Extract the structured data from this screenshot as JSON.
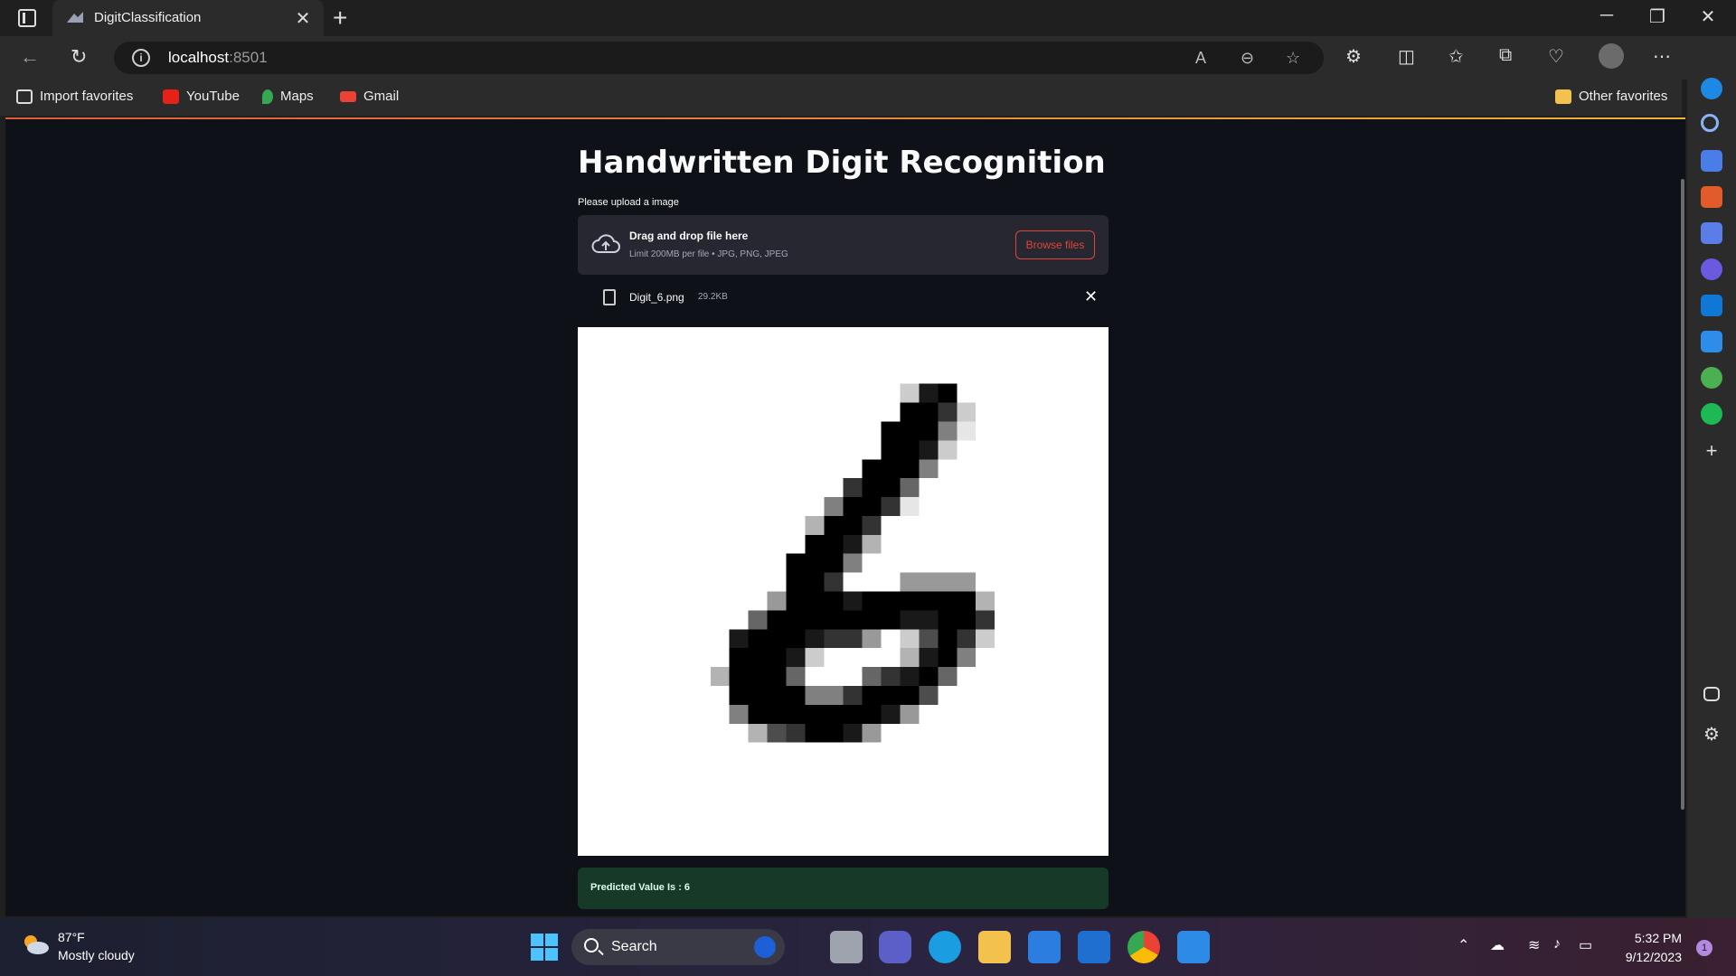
{
  "browser": {
    "tab_title": "DigitClassification",
    "url_host": "localhost",
    "url_port": ":8501"
  },
  "favorites": {
    "import": "Import favorites",
    "youtube": "YouTube",
    "maps": "Maps",
    "gmail": "Gmail",
    "other": "Other favorites"
  },
  "app": {
    "title": "Handwritten Digit Recognition",
    "upload_label": "Please upload a image",
    "dropzone_title": "Drag and drop file here",
    "dropzone_limit": "Limit 200MB per file • JPG, PNG, JPEG",
    "browse_label": "Browse files",
    "file_name": "Digit_6.png",
    "file_size": "29.2KB",
    "result_text": "Predicted Value Is : 6"
  },
  "taskbar": {
    "temp": "87°F",
    "weather": "Mostly cloudy",
    "search": "Search",
    "time": "5:32 PM",
    "date": "9/12/2023",
    "notif_count": "1"
  },
  "colors": {
    "accent_red": "#e0453a",
    "success_bg": "#173928",
    "app_bg": "#0e1117"
  }
}
